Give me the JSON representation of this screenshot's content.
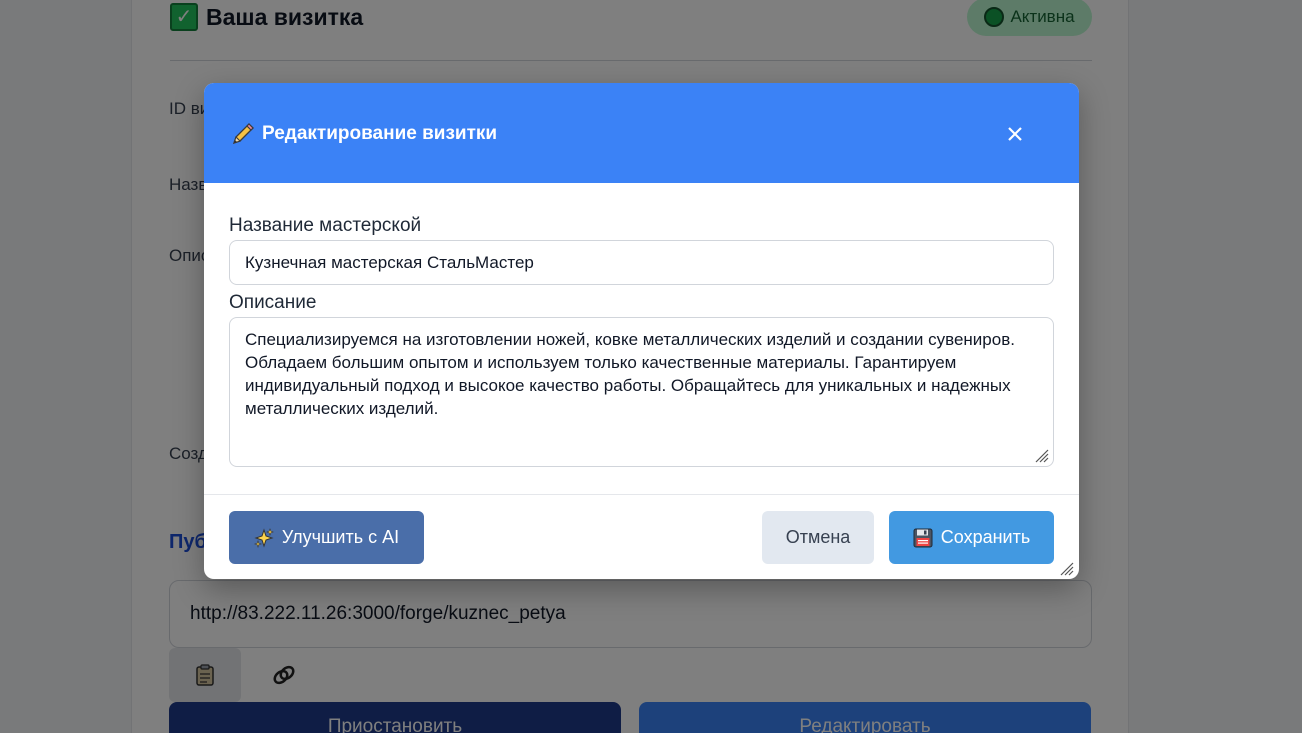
{
  "background": {
    "title": "Ваша визитка",
    "status_badge": "Активна",
    "labels": [
      "ID ви",
      "Назв",
      "Опис",
      "Созд"
    ],
    "section_title": "Пуб",
    "public_url": "http://83.222.11.26:3000/forge/kuznec_petya",
    "pause_button": "Приостановить",
    "edit_button": "Редактировать"
  },
  "modal": {
    "title": "Редактирование визитки",
    "name_label": "Название мастерской",
    "name_value": "Кузнечная мастерская СтальМастер",
    "description_label": "Описание",
    "description_value": "Специализируемся на изготовлении ножей, ковке металлических изделий и создании сувениров. Обладаем большим опытом и используем только качественные материалы. Гарантируем индивидуальный подход и высокое качество работы. Обращайтесь для уникальных и надежных металлических изделий.",
    "ai_button": "Улучшить с AI",
    "cancel_button": "Отмена",
    "save_button": "Сохранить"
  },
  "colors": {
    "header": "#3b82f6",
    "ai_button": "#4a6ea9",
    "save_button": "#4299e1",
    "cancel_button": "#e2e8f0"
  },
  "icons": {
    "title": "pencil-icon",
    "close": "close-icon",
    "ai": "sparkles-icon",
    "save": "floppy-disk-icon",
    "copy": "clipboard-icon",
    "link": "link-icon",
    "status": "green-circle-icon",
    "check": "check-box-icon"
  }
}
